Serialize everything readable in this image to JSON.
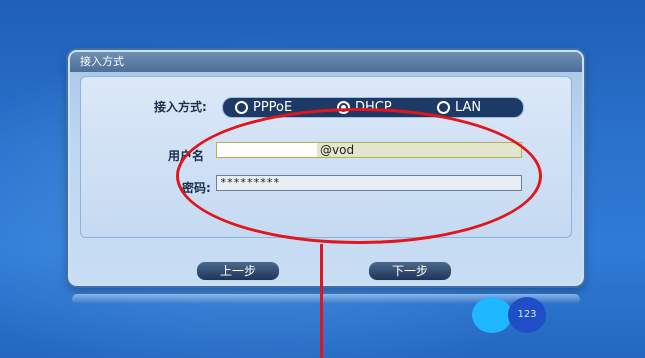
{
  "dialog": {
    "title": "接入方式",
    "access_label": "接入方式:",
    "options": [
      {
        "label": "PPPoE",
        "selected": false
      },
      {
        "label": "DHCP",
        "selected": true
      },
      {
        "label": "LAN",
        "selected": false
      }
    ],
    "username_label": "用户名",
    "username_suffix": "@vod",
    "password_label": "密码:",
    "password_value": "*********",
    "prev_button": "上一步",
    "next_button": "下一步"
  },
  "badge": {
    "number": "123"
  },
  "colors": {
    "background": "#2a72cc",
    "annotation": "#e0161b",
    "accent_cyan": "#1fb7ff"
  }
}
